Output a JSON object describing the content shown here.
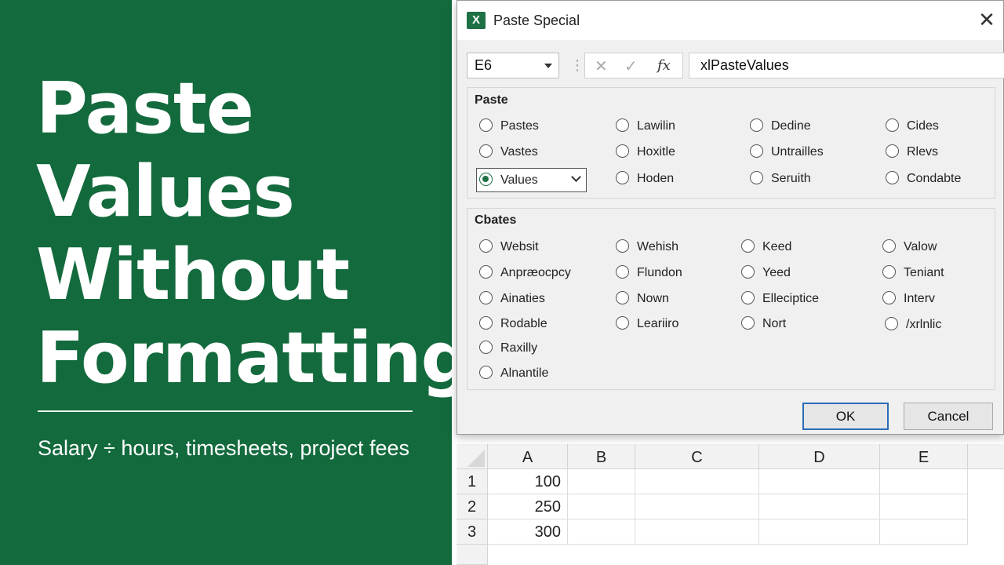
{
  "promo": {
    "title_lines": [
      "Paste",
      "Values",
      "Without",
      "Formatting"
    ],
    "subtitle": "Salary ÷ hours, timesheets, project fees",
    "background": "#136a3d"
  },
  "dialog": {
    "title": "Paste Special",
    "app_icon": "excel-icon",
    "close": "✕",
    "name_box": "E6",
    "fx_cancel": "✕",
    "fx_enter": "✓",
    "fx_label": "fx",
    "formula": "xlPasteValues",
    "paste_group": {
      "label": "Paste",
      "selected": "Values",
      "options": [
        [
          "Pastes",
          "Lawilin",
          "Dedine",
          "Cides"
        ],
        [
          "Vastes",
          "Hoxitle",
          "Untrailles",
          "Rlevs"
        ],
        [
          "Values",
          "Hoden",
          "Seruith",
          "Condabte"
        ]
      ]
    },
    "operation_group": {
      "label": "Cbates",
      "options": [
        [
          "Websit",
          "Wehish",
          "Keed",
          "Valow"
        ],
        [
          "Anpræocpcy",
          "Flundon",
          "Yeed",
          "Teniant"
        ],
        [
          "Ainaties",
          "Nown",
          "Ellecipticе",
          "Interv"
        ],
        [
          "Rodable",
          "Leariiro",
          "Nort",
          "/xrlnlic"
        ],
        [
          "Raxilly"
        ],
        [
          "Alnantile"
        ]
      ]
    },
    "ok_label": "OK",
    "cancel_label": "Cancel",
    "accent": "#1e7145"
  },
  "sheet": {
    "columns": [
      "A",
      "B",
      "C",
      "D",
      "E"
    ],
    "rows": [
      {
        "num": "1",
        "a": "100"
      },
      {
        "num": "2",
        "a": "250"
      },
      {
        "num": "3",
        "a": "300"
      }
    ]
  }
}
